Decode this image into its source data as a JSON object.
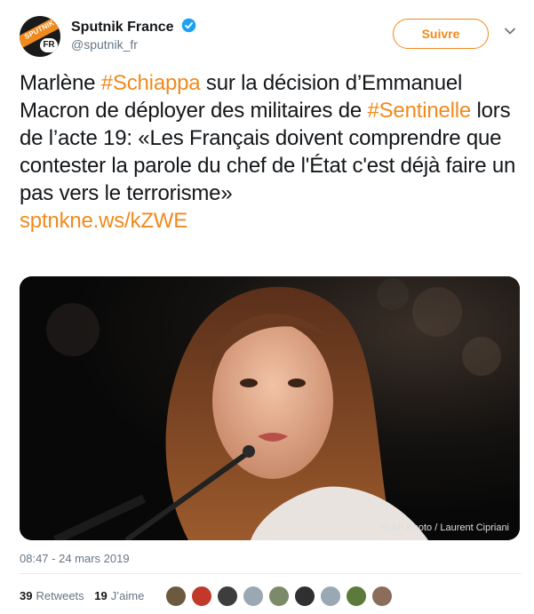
{
  "account": {
    "name": "Sputnik France",
    "handle": "@sputnik_fr",
    "avatar_wordmark": "SPUTNIK",
    "avatar_badge": "FR"
  },
  "follow_button": {
    "label": "Suivre"
  },
  "tweet": {
    "parts": [
      {
        "text": "Marlène ",
        "link": false
      },
      {
        "text": "#Schiappa",
        "link": true
      },
      {
        "text": " sur la décision d’Emmanuel Macron de déployer des militaires de ",
        "link": false
      },
      {
        "text": "#Sentinelle",
        "link": true
      },
      {
        "text": " lors de l’acte 19: «Les Français doivent comprendre que contester la parole du chef de l'État c'est déjà faire un pas vers le terrorisme»",
        "link": false
      }
    ],
    "url": "sptnkne.ws/kZWE"
  },
  "media": {
    "credit": "© AP Photo / Laurent Cipriani"
  },
  "timestamp": "08:47 - 24 mars 2019",
  "stats": {
    "retweets_count": "39",
    "retweets_label": "Retweets",
    "likes_count": "19",
    "likes_label": "J’aime"
  },
  "likers": [
    {
      "color": "#6b5a3e"
    },
    {
      "color": "#c0392b"
    },
    {
      "color": "#3d3d3d"
    },
    {
      "color": "#9aa8b4"
    },
    {
      "color": "#7d8a6a"
    },
    {
      "color": "#2f2f2f"
    },
    {
      "color": "#9aa8b4"
    },
    {
      "color": "#5c7a3a"
    },
    {
      "color": "#8a6d5a"
    }
  ],
  "colors": {
    "accent": "#f08a1d",
    "verified": "#1da1f2",
    "muted": "#657786"
  },
  "icons": {
    "verified": "verified-badge-icon",
    "menu": "chevron-down-icon"
  }
}
